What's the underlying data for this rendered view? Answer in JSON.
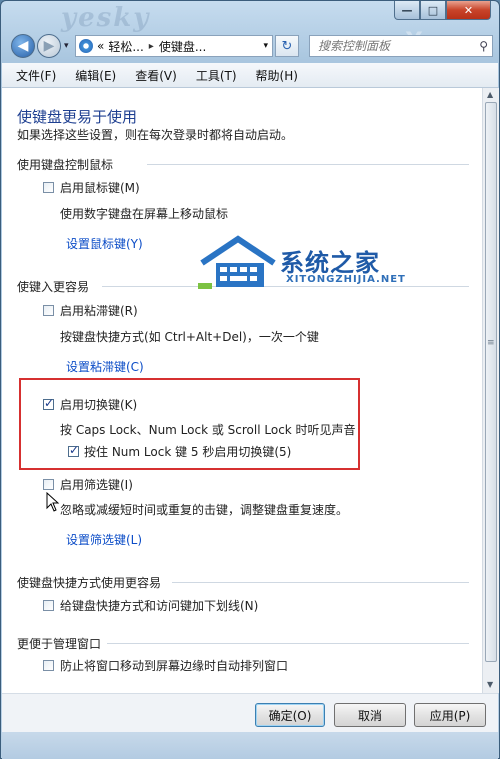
{
  "watermark": {
    "site": "yesky",
    "corner": "Yes"
  },
  "titlebar": {
    "min": "—",
    "max": "□",
    "close": "✕"
  },
  "nav": {
    "back_glyph": "◀",
    "forward_glyph": "▶",
    "dropdown_glyph": "▾",
    "address_prefix": "«",
    "crumb1": "轻松...",
    "crumb_sep": "▸",
    "crumb2": "使键盘...",
    "crumb3_sep": "▸",
    "address_dropdown": "▾",
    "refresh_glyph": "↻",
    "search_placeholder": "搜索控制面板",
    "search_glyph": "⚲"
  },
  "menu": {
    "file": "文件(F)",
    "edit": "编辑(E)",
    "view": "查看(V)",
    "tools": "工具(T)",
    "help": "帮助(H)"
  },
  "page": {
    "title": "使键盘更易于使用",
    "subtitle": "如果选择这些设置，则在每次登录时都将自动启动。",
    "section1": {
      "heading": "使用键盘控制鼠标",
      "mousekeys_label": "启用鼠标键(M)",
      "mousekeys_checked": false,
      "mousekeys_desc": "使用数字键盘在屏幕上移动鼠标",
      "mousekeys_link": "设置鼠标键(Y)"
    },
    "section2": {
      "heading": "使键入更容易",
      "sticky_label": "启用粘滞键(R)",
      "sticky_checked": false,
      "sticky_desc": "按键盘快捷方式(如 Ctrl+Alt+Del)，一次一个键",
      "sticky_link": "设置粘滞键(C)",
      "toggle_label": "启用切换键(K)",
      "toggle_checked": true,
      "toggle_desc": "按 Caps Lock、Num Lock 或 Scroll Lock 时听见声音",
      "toggle_sub_label": "按住 Num Lock 键 5 秒启用切换键(5)",
      "toggle_sub_checked": true,
      "filter_label": "启用筛选键(I)",
      "filter_checked": false,
      "filter_desc": "忽略或减缓短时间或重复的击键，调整键盘重复速度。",
      "filter_link": "设置筛选键(L)"
    },
    "section3": {
      "heading": "使键盘快捷方式使用更容易",
      "underline_label": "给键盘快捷方式和访问键加下划线(N)",
      "underline_checked": false
    },
    "section4": {
      "heading": "更便于管理窗口",
      "snap_label": "防止将窗口移动到屏幕边缘时自动排列窗口",
      "snap_checked": false
    }
  },
  "logo": {
    "name": "系统之家",
    "url": "XITONGZHIJIA.NET"
  },
  "buttons": {
    "ok": "确定(O)",
    "cancel": "取消",
    "apply": "应用(P)"
  },
  "colors": {
    "link": "#0b4cc7",
    "heading": "#1e3f91",
    "highlight_box": "#d63030"
  }
}
